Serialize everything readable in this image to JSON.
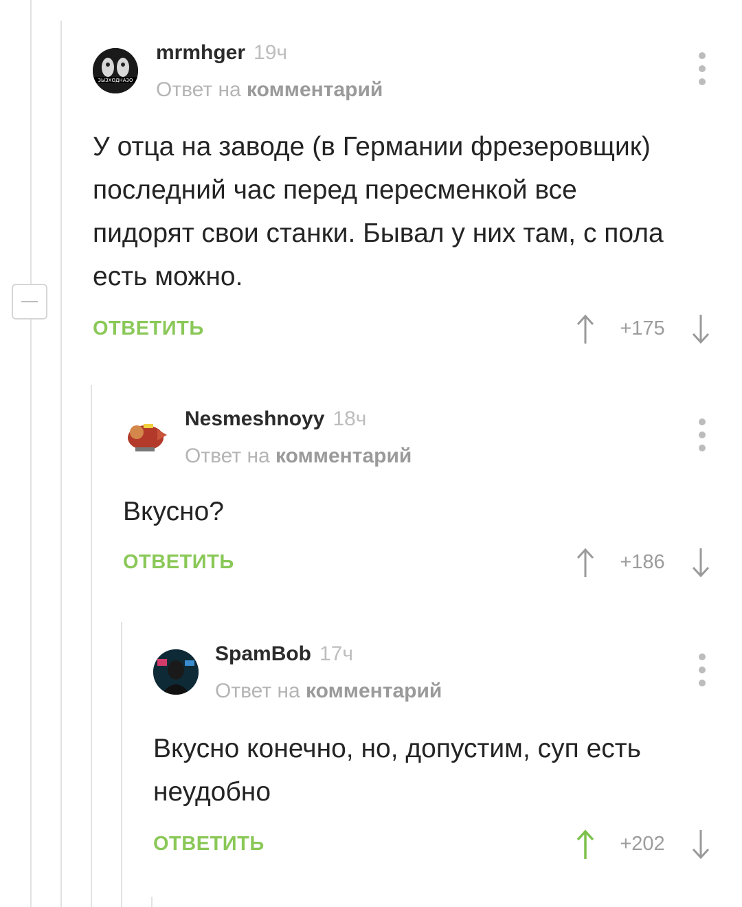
{
  "comments": [
    {
      "author": "mrmhger",
      "time": "19ч",
      "reply_prefix": "Ответ на",
      "reply_link": "комментарий",
      "text": "У отца на заводе (в Германии фрезеровщик) последний час перед пересменкой все пидорят свои станки. Бывал у них там, с пола есть можно.",
      "reply_label": "ОТВЕТИТЬ",
      "score": "+175",
      "upvoted": false
    },
    {
      "author": "Nesmeshnoyy",
      "time": "18ч",
      "reply_prefix": "Ответ на",
      "reply_link": "комментарий",
      "text": "Вкусно?",
      "reply_label": "ОТВЕТИТЬ",
      "score": "+186",
      "upvoted": false
    },
    {
      "author": "SpamBob",
      "time": "17ч",
      "reply_prefix": "Ответ на",
      "reply_link": "комментарий",
      "text": "Вкусно конечно, но, допустим, суп есть неудобно",
      "reply_label": "ОТВЕТИТЬ",
      "score": "+202",
      "upvoted": true
    }
  ],
  "avatars": {
    "mrmhger_logo_text": "ЗЫЗХОДНАЗО"
  },
  "colors": {
    "accent_green": "#8ac858",
    "muted_gray": "#b5b5b5",
    "thread_line": "#e2e2e2"
  }
}
